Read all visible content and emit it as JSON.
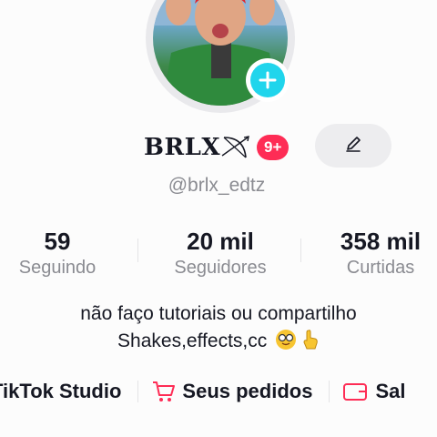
{
  "profile": {
    "name": "BRLX",
    "name_symbol": "🏹",
    "notification_badge": "9+",
    "handle": "@brlx_edtz"
  },
  "stats": [
    {
      "value": "59",
      "label": "Seguindo"
    },
    {
      "value": "20 mil",
      "label": "Seguidores"
    },
    {
      "value": "358 mil",
      "label": "Curtidas"
    }
  ],
  "bio": {
    "line1": "não faço tutoriais ou compartilho",
    "line2": "Shakes,effects,cc"
  },
  "links": {
    "studio": "TikTok Studio",
    "orders": "Seus pedidos",
    "balance": "Sal"
  },
  "colors": {
    "accent_red": "#fe2c55",
    "add_blue": "#20d5ec",
    "secondary_text": "#8a8b91"
  },
  "icons": [
    "add-icon",
    "bow-arrow-icon",
    "pencil-icon",
    "cart-icon",
    "wallet-icon",
    "nerd-emoji-icon",
    "pointing-hand-icon"
  ]
}
